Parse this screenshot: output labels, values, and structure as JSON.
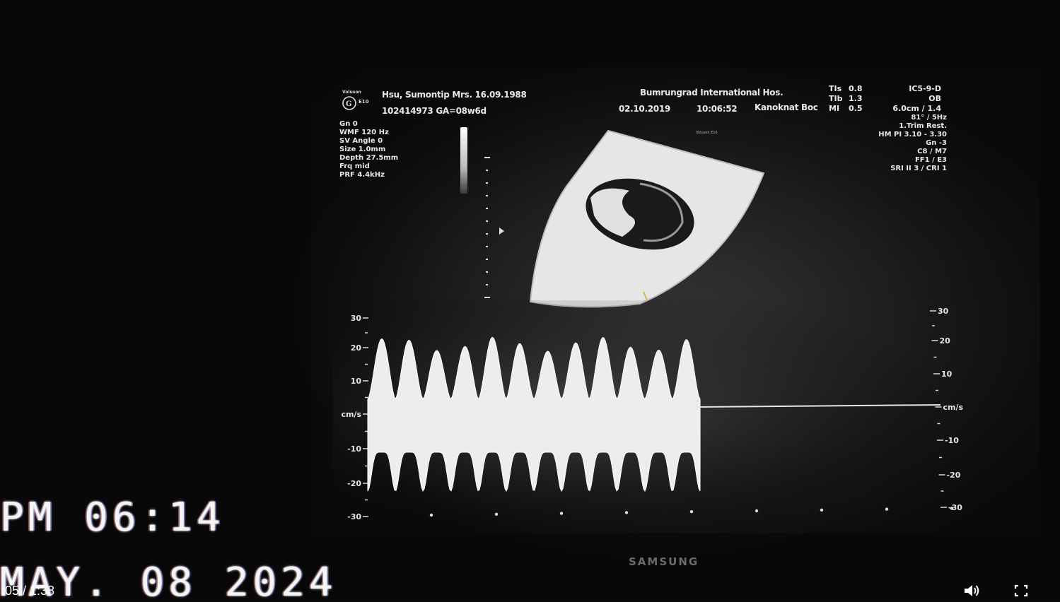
{
  "player": {
    "time_display": ":05 / 1:38",
    "icons": {
      "volume": "volume-icon",
      "fullscreen": "fullscreen-icon"
    }
  },
  "osd": {
    "time": "PM 06:14",
    "date": "MAY. 08 2024"
  },
  "ultrasound": {
    "logo_label": "Voluson E10",
    "patient_line": "Hsu, Sumontip  Mrs. 16.09.1988",
    "id_line": "102414973  GA=08w6d",
    "hospital": "Bumrungrad International Hos.",
    "date": "02.10.2019",
    "time": "10:06:52",
    "operator": "Kanoknat Boc",
    "tis_labels": [
      "TIs",
      "TIb",
      "MI"
    ],
    "tis_values": [
      "0.8",
      "1.3",
      "0.5"
    ],
    "probe": [
      "IC5-9-D",
      "OB",
      "6.0cm / 1.4"
    ],
    "left_params": [
      "Gn  0",
      "WMF 120 Hz",
      "SV Angle  0",
      "Size  1.0mm",
      "Depth 27.5mm",
      "Frq mid",
      "PRF  4.4kHz"
    ],
    "right_params": [
      "81° / 5Hz",
      "1.Trim Rest.",
      "HM PI 3.10 - 3.30",
      "Gn  -3",
      "C8 / M7",
      "FF1 / E3",
      "SRI II 3 / CRI 1"
    ],
    "mini_label": "Voluson E10",
    "left_scale_labels": [
      "30",
      "20",
      "10",
      "cm/s",
      "-10",
      "-20",
      "-30"
    ],
    "right_scale_labels": [
      "30",
      "20",
      "10",
      "cm/s",
      "-10",
      "-20",
      "-30"
    ],
    "brand": "SAMSUNG"
  }
}
